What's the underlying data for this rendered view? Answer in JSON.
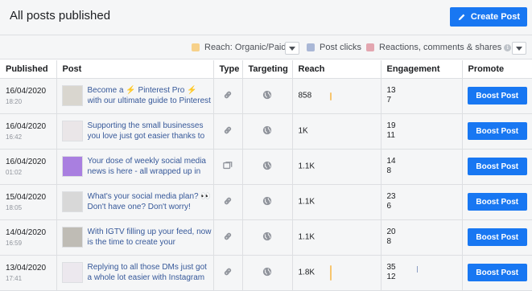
{
  "header": {
    "title": "All posts published",
    "create_label": "Create Post"
  },
  "legend": {
    "items": [
      {
        "label": "Reach: Organic/Paid",
        "color": "#f7d18a"
      },
      {
        "label": "Post clicks",
        "color": "#a9b7d6"
      },
      {
        "label": "Reactions, comments & shares",
        "color": "#e3a6b0"
      }
    ]
  },
  "table": {
    "headers": [
      "Published",
      "Post",
      "Type",
      "Targeting",
      "Reach",
      "Engagement",
      "Promote"
    ],
    "rows": [
      {
        "date": "16/04/2020",
        "time": "18:20",
        "text": "Become a ⚡ Pinterest Pro ⚡ with our ultimate guide to Pinterest",
        "type": "link-icon",
        "reach": "858",
        "reach_level": 0.45,
        "eng1": "13",
        "eng2": "7",
        "boost": "Boost Post",
        "thumb": "#d9d6cf"
      },
      {
        "date": "16/04/2020",
        "time": "16:42",
        "text": "Supporting the small businesses you love just got easier thanks to",
        "type": "link-icon",
        "reach": "1K",
        "reach_level": 0.0,
        "eng1": "19",
        "eng2": "11",
        "boost": "Boost Post",
        "thumb": "#eae6e8"
      },
      {
        "date": "16/04/2020",
        "time": "01:02",
        "text": "Your dose of weekly social media news is here - all wrapped up in",
        "type": "album-icon",
        "reach": "1.1K",
        "reach_level": 0.0,
        "eng1": "14",
        "eng2": "8",
        "boost": "Boost Post",
        "thumb": "#a97fe0"
      },
      {
        "date": "15/04/2020",
        "time": "18:05",
        "text": "What's your social media plan? 👀 Don't have one? Don't worry!",
        "type": "link-icon",
        "reach": "1.1K",
        "reach_level": 0.0,
        "eng1": "23",
        "eng2": "6",
        "boost": "Boost Post",
        "thumb": "#d8d8d8"
      },
      {
        "date": "14/04/2020",
        "time": "16:59",
        "text": "With IGTV filling up your feed, now is the time to create your",
        "type": "link-icon",
        "reach": "1.1K",
        "reach_level": 0.0,
        "eng1": "20",
        "eng2": "8",
        "boost": "Boost Post",
        "thumb": "#bfbcb5"
      },
      {
        "date": "13/04/2020",
        "time": "17:41",
        "text": "Replying to all those DMs just got a whole lot easier with Instagram",
        "type": "link-icon",
        "reach": "1.8K",
        "reach_level": 0.85,
        "eng1": "35",
        "eng2": "12",
        "boost": "Boost Post",
        "thumb": "#ece8ee"
      }
    ]
  }
}
